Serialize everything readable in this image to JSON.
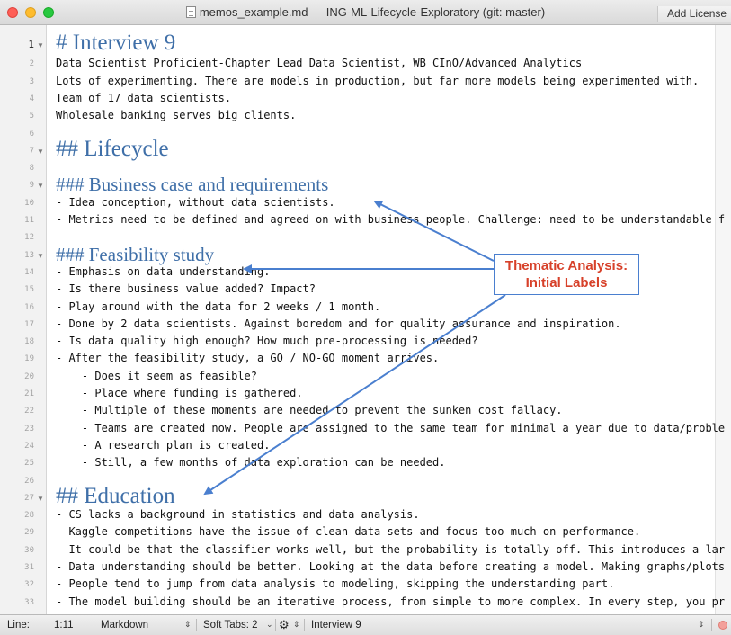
{
  "window": {
    "title": "memos_example.md — ING-ML-Lifecycle-Exploratory (git: master)",
    "add_license": "Add License"
  },
  "editor": {
    "lines": [
      {
        "n": "1",
        "style": "h1",
        "text": "# Interview 9",
        "fold": true,
        "current": true
      },
      {
        "n": "2",
        "style": "body",
        "text": "Data Scientist Proficient-Chapter Lead Data Scientist, WB CInO/Advanced Analytics"
      },
      {
        "n": "3",
        "style": "body",
        "text": "Lots of experimenting. There are models in production, but far more models being experimented with."
      },
      {
        "n": "4",
        "style": "body",
        "text": "Team of 17 data scientists."
      },
      {
        "n": "5",
        "style": "body",
        "text": "Wholesale banking serves big clients."
      },
      {
        "n": "6",
        "style": "body",
        "text": ""
      },
      {
        "n": "7",
        "style": "h2",
        "text": "## Lifecycle",
        "fold": true
      },
      {
        "n": "8",
        "style": "body",
        "text": ""
      },
      {
        "n": "9",
        "style": "h3",
        "text": "### Business case and requirements",
        "fold": true
      },
      {
        "n": "10",
        "style": "body",
        "text": "- Idea conception, without data scientists."
      },
      {
        "n": "11",
        "style": "body",
        "text": "- Metrics need to be defined and agreed on with business people. Challenge: need to be understandable f"
      },
      {
        "n": "12",
        "style": "body",
        "text": ""
      },
      {
        "n": "13",
        "style": "h3",
        "text": "### Feasibility study",
        "fold": true
      },
      {
        "n": "14",
        "style": "body",
        "text": "- Emphasis on data understanding."
      },
      {
        "n": "15",
        "style": "body",
        "text": "- Is there business value added? Impact?"
      },
      {
        "n": "16",
        "style": "body",
        "text": "- Play around with the data for 2 weeks / 1 month."
      },
      {
        "n": "17",
        "style": "body",
        "text": "- Done by 2 data scientists. Against boredom and for quality assurance and inspiration."
      },
      {
        "n": "18",
        "style": "body",
        "text": "- Is data quality high enough? How much pre-processing is needed?"
      },
      {
        "n": "19",
        "style": "body",
        "text": "- After the feasibility study, a GO / NO-GO moment arrives."
      },
      {
        "n": "20",
        "style": "body",
        "text": "    - Does it seem as feasible?"
      },
      {
        "n": "21",
        "style": "body",
        "text": "    - Place where funding is gathered."
      },
      {
        "n": "22",
        "style": "body",
        "text": "    - Multiple of these moments are needed to prevent the sunken cost fallacy."
      },
      {
        "n": "23",
        "style": "body",
        "text": "    - Teams are created now. People are assigned to the same team for minimal a year due to data/proble"
      },
      {
        "n": "24",
        "style": "body",
        "text": "    - A research plan is created."
      },
      {
        "n": "25",
        "style": "body",
        "text": "    - Still, a few months of data exploration can be needed."
      },
      {
        "n": "26",
        "style": "body",
        "text": ""
      },
      {
        "n": "27",
        "style": "h2",
        "text": "## Education",
        "fold": true
      },
      {
        "n": "28",
        "style": "body",
        "text": "- CS lacks a background in statistics and data analysis."
      },
      {
        "n": "29",
        "style": "body",
        "text": "- Kaggle competitions have the issue of clean data sets and focus too much on performance."
      },
      {
        "n": "30",
        "style": "body",
        "text": "- It could be that the classifier works well, but the probability is totally off. This introduces a lar"
      },
      {
        "n": "31",
        "style": "body",
        "text": "- Data understanding should be better. Looking at the data before creating a model. Making graphs/plots"
      },
      {
        "n": "32",
        "style": "body",
        "text": "- People tend to jump from data analysis to modeling, skipping the understanding part."
      },
      {
        "n": "33",
        "style": "body",
        "text": "- The model building should be an iterative process, from simple to more complex. In every step, you pr"
      }
    ]
  },
  "annotation": {
    "line1": "Thematic Analysis:",
    "line2": "Initial Labels",
    "box_color": "#4a7fcf",
    "text_color": "#d7412a"
  },
  "statusbar": {
    "line_label": "Line:",
    "line_value": "1:11",
    "language": "Markdown",
    "soft_tabs": "Soft Tabs:",
    "tab_size": "2",
    "symbol": "Interview 9"
  },
  "colors": {
    "heading": "#3f6fa8",
    "gutter": "#f2f2f2",
    "arrow": "#4a7fcf"
  }
}
